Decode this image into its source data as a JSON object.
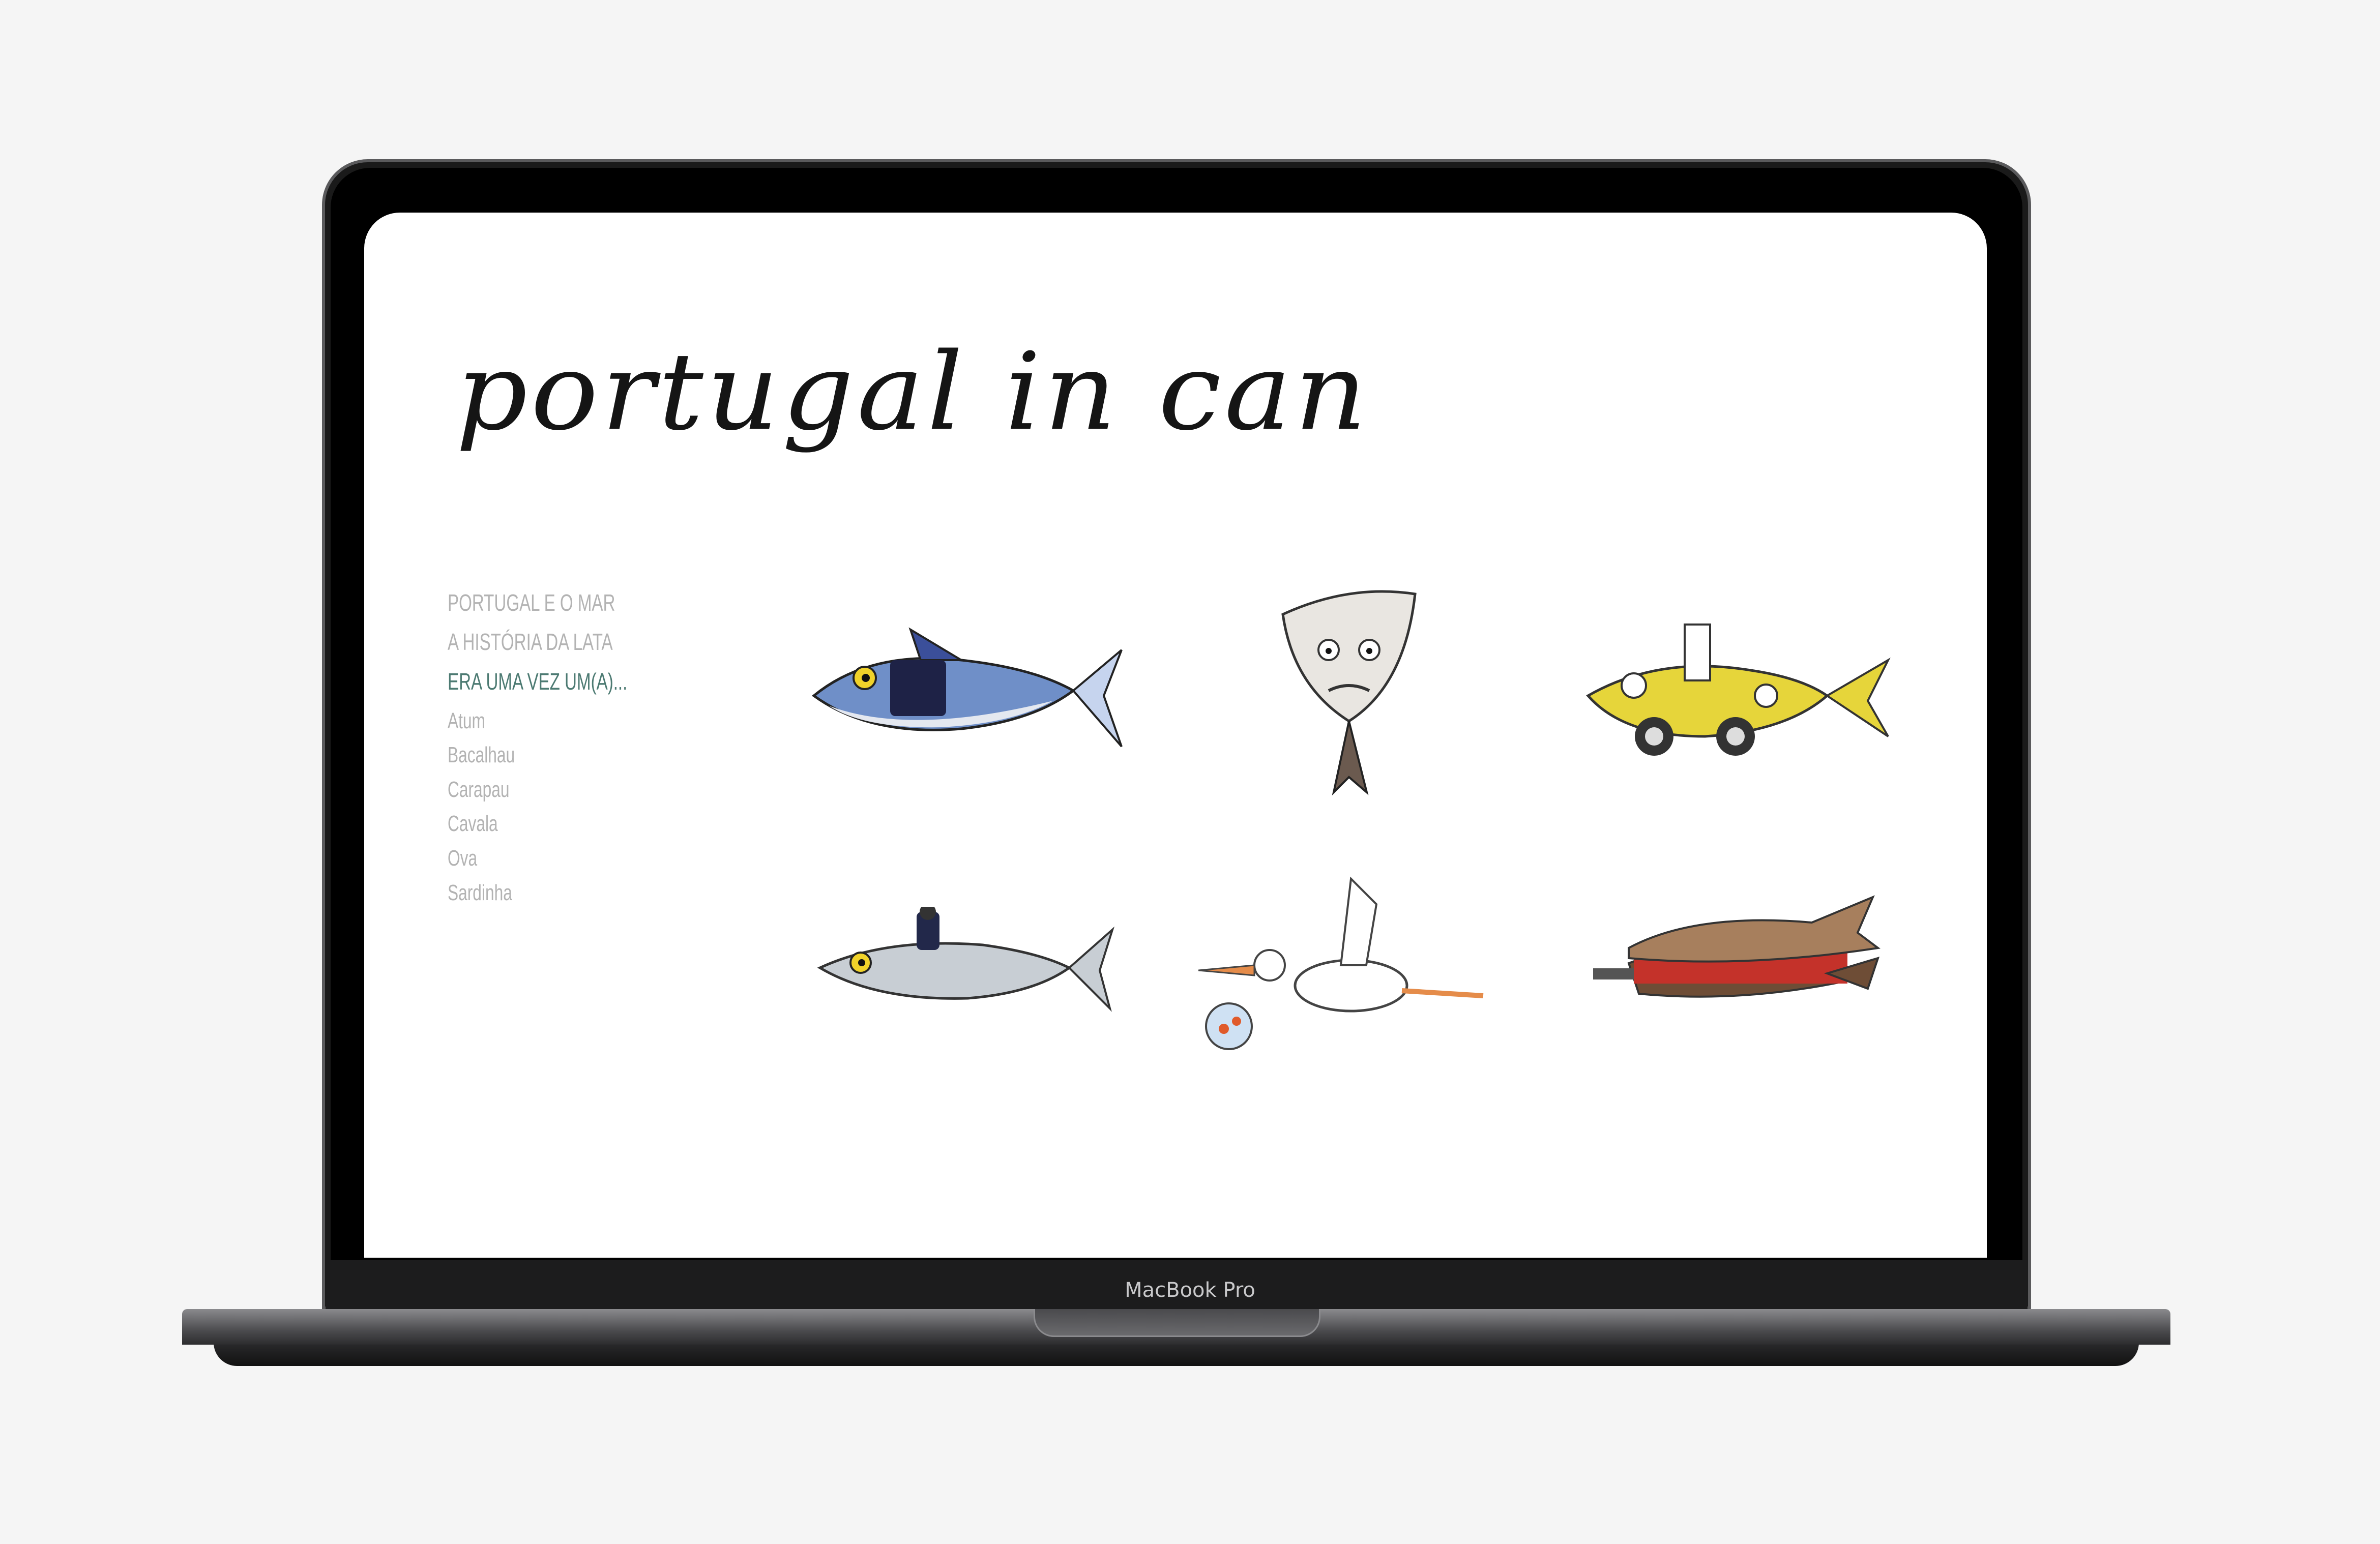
{
  "site": {
    "logo_text": "portugal in can"
  },
  "nav": {
    "main": [
      {
        "label": "PORTUGAL E O MAR",
        "active": false
      },
      {
        "label": "A HISTÓRIA DA LATA",
        "active": false
      },
      {
        "label": "ERA UMA VEZ UM(A)...",
        "active": true
      }
    ],
    "sub": [
      "Atum",
      "Bacalhau",
      "Carapau",
      "Cavala",
      "Ova",
      "Sardinha"
    ]
  },
  "device": {
    "label": "MacBook Pro"
  },
  "colors": {
    "active_nav": "#4c7a72",
    "nav": "#b3b3b3",
    "background": "#f5f5f5"
  }
}
